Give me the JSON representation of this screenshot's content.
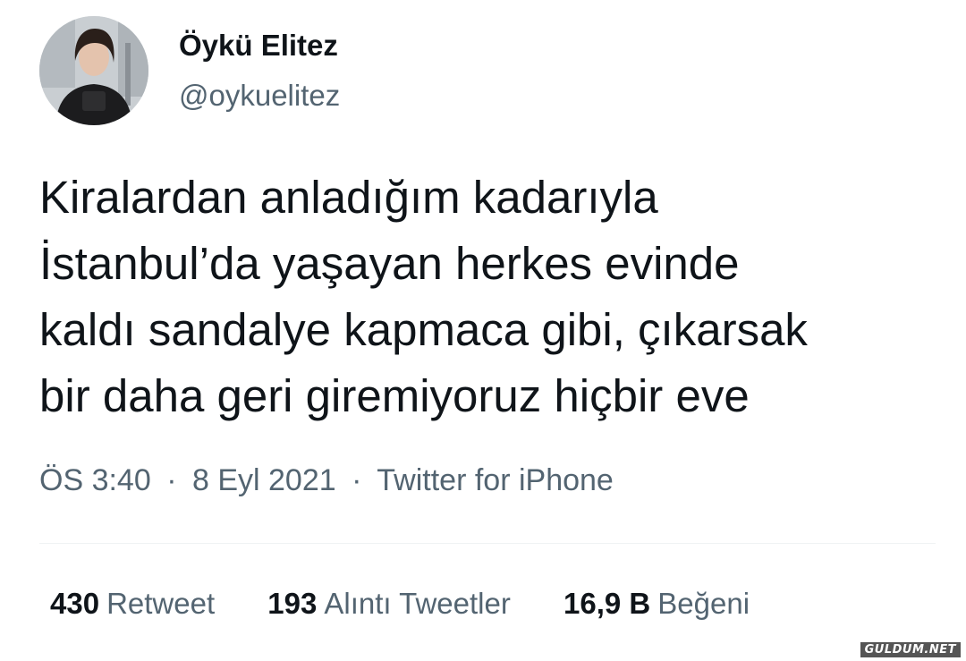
{
  "author": {
    "name": "Öykü Elitez",
    "handle": "@oykuelitez"
  },
  "tweet": {
    "lines": [
      "Kiralardan anladığım kadarıyla",
      "İstanbul’da yaşayan herkes evinde",
      "kaldı sandalye kapmaca gibi, çıkarsak",
      "bir daha geri giremiyoruz hiçbir eve"
    ],
    "time": "ÖS 3:40",
    "date": "8 Eyl 2021",
    "source": "Twitter for iPhone",
    "separator": "·"
  },
  "stats": {
    "retweets": {
      "count": "430",
      "label": "Retweet"
    },
    "quotes": {
      "count": "193",
      "label": "Alıntı Tweetler"
    },
    "likes": {
      "count": "16,9 B",
      "label": "Beğeni"
    }
  },
  "watermark": "GULDUM.NET",
  "colors": {
    "text_primary": "#0f1419",
    "text_secondary": "#536471",
    "divider": "#eff3f4"
  }
}
